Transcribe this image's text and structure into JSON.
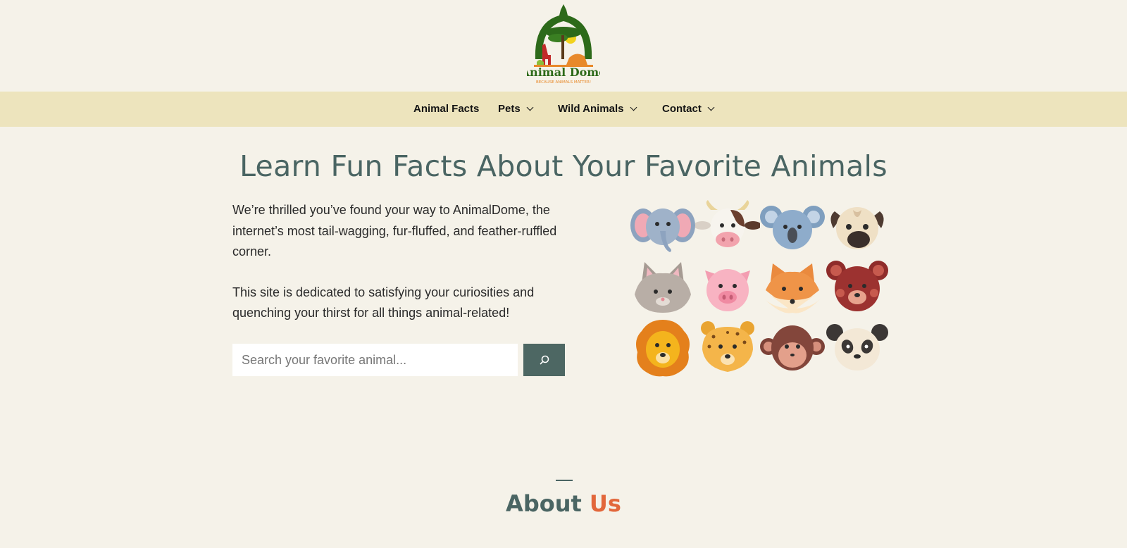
{
  "brand": {
    "name": "Animal Dome",
    "tagline": "BECAUSE ANIMALS MATTER!"
  },
  "nav": {
    "items": [
      {
        "label": "Animal Facts",
        "has_dropdown": false
      },
      {
        "label": "Pets",
        "has_dropdown": true
      },
      {
        "label": "Wild Animals",
        "has_dropdown": true
      },
      {
        "label": "Contact",
        "has_dropdown": true
      }
    ]
  },
  "hero": {
    "title": "Learn Fun Facts About Your Favorite Animals",
    "paragraphs": [
      "We’re thrilled you’ve found your way to AnimalDome, the internet’s most tail-wagging, fur-fluffed, and feather-ruffled corner.",
      "This site is dedicated to satisfying your curiosities and quenching your thirst for all things animal-related!"
    ]
  },
  "search": {
    "placeholder": "Search your favorite animal...",
    "value": "",
    "button_icon": "search-icon"
  },
  "animal_grid": [
    "elephant",
    "cow",
    "koala",
    "pug",
    "cat",
    "pig",
    "fox",
    "bear",
    "lion",
    "cheetah",
    "monkey",
    "panda"
  ],
  "about": {
    "title_part1": "About",
    "title_part2": "Us"
  },
  "colors": {
    "background": "#f5f2e9",
    "nav_background": "#ede4bd",
    "heading": "#4a6563",
    "accent": "#e2673b",
    "button": "#4d6763",
    "logo_green": "#2d6a1a"
  }
}
